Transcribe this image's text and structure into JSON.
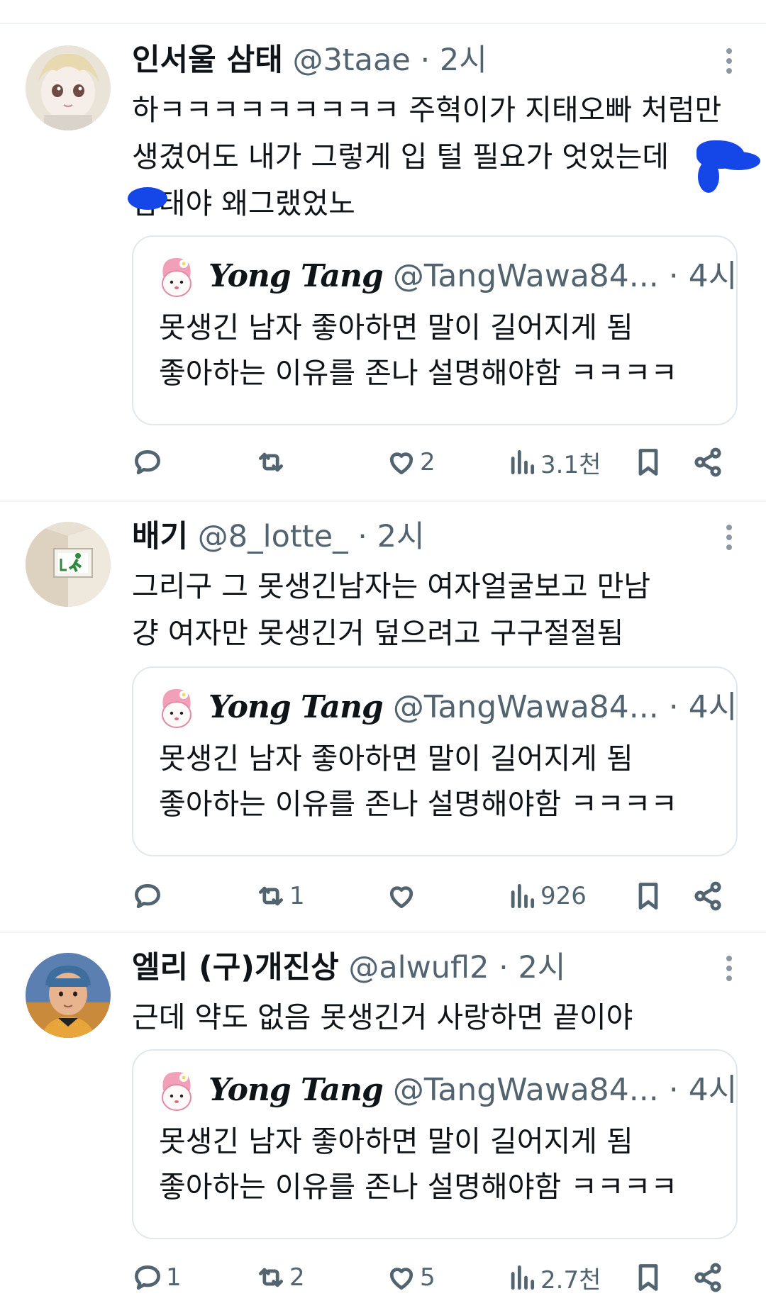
{
  "posts": [
    {
      "name": "인서울 삼태",
      "handle": "@3taae",
      "time": "2시",
      "text": [
        "하ㅋㅋㅋㅋㅋㅋㅋㅋㅋ 주혁이가 지태오빠 처럼만",
        "생겼어도 내가 그렇게 입 털 필요가 엇었는데",
        "    삼태야 왜그랬었노"
      ],
      "quote": {
        "name": "Yong Tang",
        "handle": "@TangWawa84...",
        "time": "· 4시",
        "text": [
          "못생긴 남자 좋아하면 말이 길어지게 됨",
          "좋아하는 이유를 존나 설명해야함 ㅋㅋㅋㅋ"
        ]
      },
      "actions": {
        "replies": "",
        "retweets": "",
        "likes": "2",
        "views": "3.1천"
      }
    },
    {
      "name": "배기",
      "handle": "@8_lotte_",
      "time": "2시",
      "text": [
        "그리구 그 못생긴남자는 여자얼굴보고 만남",
        "걍 여자만 못생긴거 덮으려고 구구절절됨"
      ],
      "quote": {
        "name": "Yong Tang",
        "handle": "@TangWawa84...",
        "time": "· 4시",
        "text": [
          "못생긴 남자 좋아하면 말이 길어지게 됨",
          "좋아하는 이유를 존나 설명해야함 ㅋㅋㅋㅋ"
        ]
      },
      "actions": {
        "replies": "",
        "retweets": "1",
        "likes": "",
        "views": "926"
      }
    },
    {
      "name": "엘리 (구)개진상",
      "handle": "@alwufl2",
      "time": "2시",
      "text": [
        "근데 약도 없음 못생긴거 사랑하면 끝이야"
      ],
      "quote": {
        "name": "Yong Tang",
        "handle": "@TangWawa84...",
        "time": "· 4시",
        "text": [
          "못생긴 남자 좋아하면 말이 길어지게 됨",
          "좋아하는 이유를 존나 설명해야함 ㅋㅋㅋㅋ"
        ]
      },
      "actions": {
        "replies": "1",
        "retweets": "2",
        "likes": "5",
        "views": "2.7천"
      }
    }
  ],
  "icons": {
    "reply": "reply-icon",
    "retweet": "retweet-icon",
    "like": "heart-icon",
    "views": "views-icon",
    "bookmark": "bookmark-icon",
    "share": "share-icon",
    "more": "more-icon"
  },
  "colors": {
    "text": "#0f1419",
    "secondary": "#536471",
    "border": "#e1e8ed",
    "redaction": "#1446e8"
  }
}
